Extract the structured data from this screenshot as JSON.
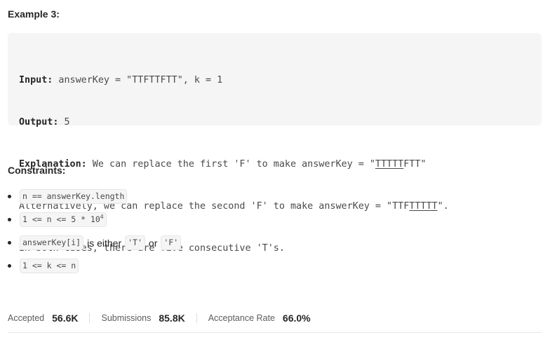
{
  "example": {
    "heading": "Example 3:",
    "input_label": "Input:",
    "input_value": " answerKey = \"TTFTTFTT\", k = 1",
    "output_label": "Output:",
    "output_value": " 5",
    "explanation_label": "Explanation:",
    "explanation_pre": " We can replace the first 'F' to make answerKey = \"",
    "explanation_u1": "TTTTT",
    "explanation_post": "FTT\"",
    "alt_pre": "Alternatively, we can replace the second 'F' to make answerKey = \"TTF",
    "alt_u": "TTTTT",
    "alt_post": "\".",
    "conclusion": "In both cases, there are five consecutive 'T's."
  },
  "constraints": {
    "heading": "Constraints:",
    "c1_code": "n == answerKey.length",
    "c2_code": "1 <= n <= 5 * 10",
    "c2_sup": "4",
    "c3_code": "answerKey[i]",
    "c3_text1": "is either",
    "c3_code2": "'T'",
    "c3_text2": "or",
    "c3_code3": "'F'",
    "c4_code": "1 <= k <= n"
  },
  "stats": {
    "accepted_label": "Accepted",
    "accepted_value": "56.6K",
    "submissions_label": "Submissions",
    "submissions_value": "85.8K",
    "rate_label": "Acceptance Rate",
    "rate_value": "66.0%"
  }
}
